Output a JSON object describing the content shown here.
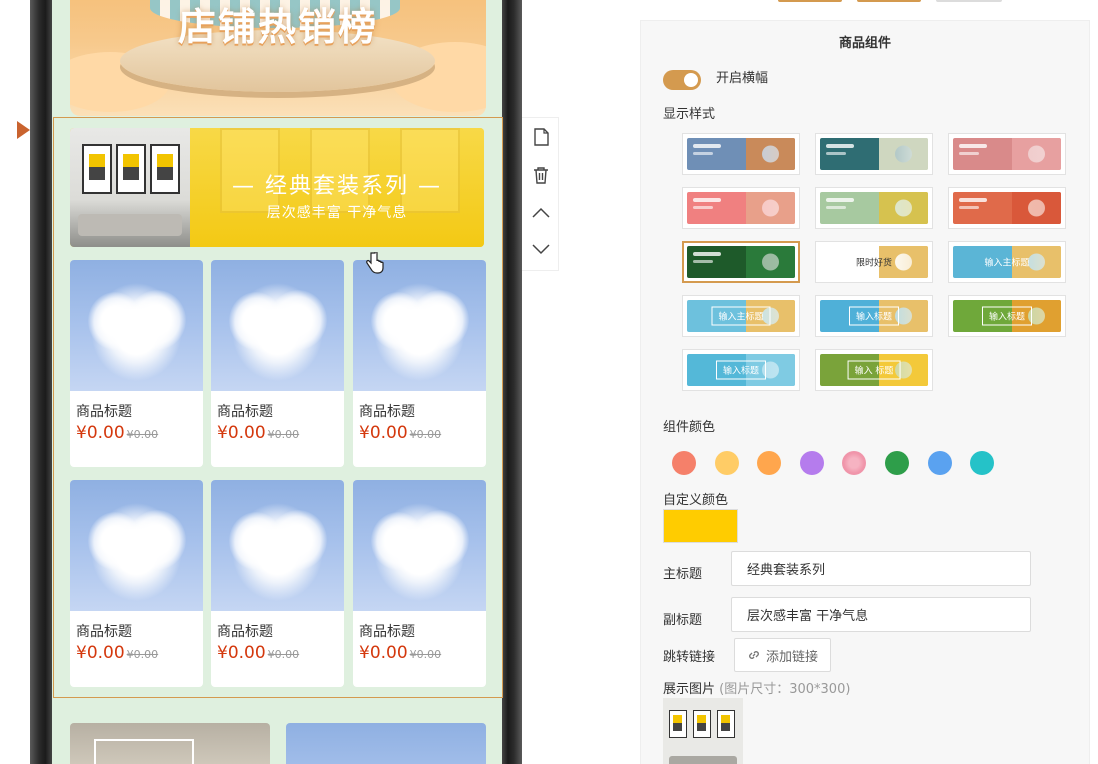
{
  "preview": {
    "hero_title": "店铺热销榜",
    "banner": {
      "main_title": "— 经典套装系列 —",
      "sub_title": "层次感丰富 干净气息"
    },
    "products": [
      {
        "title": "商品标题",
        "price": "¥0.00",
        "old_price": "¥0.00"
      },
      {
        "title": "商品标题",
        "price": "¥0.00",
        "old_price": "¥0.00"
      },
      {
        "title": "商品标题",
        "price": "¥0.00",
        "old_price": "¥0.00"
      },
      {
        "title": "商品标题",
        "price": "¥0.00",
        "old_price": "¥0.00"
      },
      {
        "title": "商品标题",
        "price": "¥0.00",
        "old_price": "¥0.00"
      },
      {
        "title": "商品标题",
        "price": "¥0.00",
        "old_price": "¥0.00"
      }
    ]
  },
  "toolbar": {
    "icons": [
      "copy-icon",
      "trash-icon",
      "chevron-up-icon",
      "chevron-down-icon"
    ]
  },
  "panel": {
    "title": "商品组件",
    "banner_toggle_label": "开启横幅",
    "banner_toggle_on": true,
    "display_style_label": "显示样式",
    "styles": [
      {
        "text": "",
        "colors": [
          "#6f8fb6",
          "#c98a5a"
        ]
      },
      {
        "text": "",
        "colors": [
          "#2f6d73",
          "#cfd7c0"
        ]
      },
      {
        "text": "",
        "colors": [
          "#d98a8a",
          "#e7a0a0"
        ]
      },
      {
        "text": "",
        "colors": [
          "#f08080",
          "#e8a08a"
        ]
      },
      {
        "text": "",
        "colors": [
          "#a7c9a0",
          "#d6c24f"
        ]
      },
      {
        "text": "",
        "colors": [
          "#e06a4a",
          "#d9583a"
        ]
      },
      {
        "text": "",
        "colors": [
          "#1e5a2a",
          "#2a7a3a"
        ]
      },
      {
        "text": "限时好货",
        "colors": [
          "#ffffff",
          "#e8c06a"
        ]
      },
      {
        "text": "输入主标题",
        "colors": [
          "#5bb5d6",
          "#e8c06a"
        ]
      },
      {
        "text": "输入主标题",
        "colors": [
          "#6dc1dd",
          "#e8c06a"
        ]
      },
      {
        "text": "输入标题",
        "colors": [
          "#4fb0d8",
          "#e8c06a"
        ]
      },
      {
        "text": "输入标题",
        "colors": [
          "#6fa83a",
          "#e0a030"
        ]
      },
      {
        "text": "输入标题",
        "colors": [
          "#54b8d8",
          "#7fcbe3"
        ]
      },
      {
        "text": "输入\n标题",
        "colors": [
          "#7aa33a",
          "#f3c93a"
        ]
      }
    ],
    "active_style_index": 6,
    "color_label": "组件颜色",
    "swatches": [
      "#f5806a",
      "#ffcc66",
      "#ffa64d",
      "#b57ced",
      "#f095aa",
      "#2e9e4a",
      "#5aa2f0",
      "#25c2c8"
    ],
    "custom_color_label": "自定义颜色",
    "custom_color": "#ffcc00",
    "main_title_label": "主标题",
    "main_title_value": "经典套装系列",
    "sub_title_label": "副标题",
    "sub_title_value": "层次感丰富 干净气息",
    "link_label": "跳转链接",
    "add_link_label": "添加链接",
    "image_label": "展示图片",
    "image_hint": "(图片尺寸：300*300)"
  }
}
